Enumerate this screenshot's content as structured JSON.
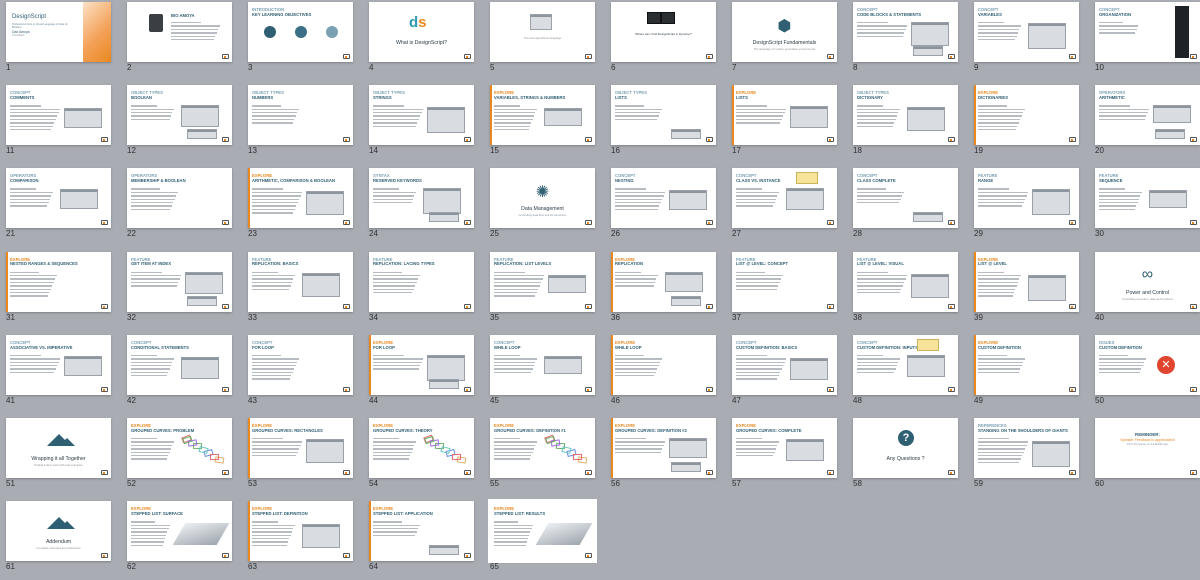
{
  "app": {
    "view": "Slide Sorter"
  },
  "slides": [
    {
      "n": "1",
      "layout": "title",
      "title": "DesignScript",
      "subtitle": "Professional Intro to Visual Language of Data for Builders",
      "presenter": "Dan Amoya",
      "role": "Consultant"
    },
    {
      "n": "2",
      "layout": "bio",
      "kicker": "",
      "title": "Bio Amoya"
    },
    {
      "n": "3",
      "layout": "objectives",
      "kicker": "Introduction",
      "title": "Key Learning Objectives"
    },
    {
      "n": "4",
      "layout": "ds",
      "kicker": "",
      "title": "What is DesignScript?"
    },
    {
      "n": "5",
      "layout": "media",
      "kicker": "",
      "title": "",
      "caption": "The best algorithmic language"
    },
    {
      "n": "6",
      "layout": "darkshots",
      "kicker": "",
      "title": "Where can I find DesignScript in Dynamo?"
    },
    {
      "n": "7",
      "layout": "section",
      "kicker": "",
      "title": "DesignScript Fundamentals",
      "sub": "The language of modern generative environments",
      "icon": "cube-icon",
      "glyph": "⬢"
    },
    {
      "n": "8",
      "layout": "concept",
      "kicker": "Concept",
      "title": "Code Blocks & Statements"
    },
    {
      "n": "9",
      "layout": "concept",
      "kicker": "Concept",
      "title": "Variables"
    },
    {
      "n": "10",
      "layout": "tall",
      "kicker": "Concept",
      "title": "Organization"
    },
    {
      "n": "11",
      "layout": "concept",
      "kicker": "Concept",
      "title": "Comments"
    },
    {
      "n": "12",
      "layout": "concept",
      "kicker": "Object Types",
      "title": "Boolean"
    },
    {
      "n": "13",
      "layout": "concept",
      "kicker": "Object Types",
      "title": "Numbers"
    },
    {
      "n": "14",
      "layout": "concept",
      "kicker": "Object Types",
      "title": "Strings"
    },
    {
      "n": "15",
      "layout": "explore",
      "kicker": "Explore",
      "title": "Variables, Strings & Numbers"
    },
    {
      "n": "16",
      "layout": "concept",
      "kicker": "Object Types",
      "title": "Lists"
    },
    {
      "n": "17",
      "layout": "explore",
      "kicker": "Explore",
      "title": "Lists"
    },
    {
      "n": "18",
      "layout": "concept",
      "kicker": "Object Types",
      "title": "Dictionary"
    },
    {
      "n": "19",
      "layout": "explore",
      "kicker": "Explore",
      "title": "Dictionaries"
    },
    {
      "n": "20",
      "layout": "concept",
      "kicker": "Operators",
      "title": "Arithmetic"
    },
    {
      "n": "21",
      "layout": "concept",
      "kicker": "Operators",
      "title": "Comparison"
    },
    {
      "n": "22",
      "layout": "concept",
      "kicker": "Operators",
      "title": "Membership & Boolean"
    },
    {
      "n": "23",
      "layout": "explore",
      "kicker": "Explore",
      "title": "Arithmetic, Comparison & Boolean"
    },
    {
      "n": "24",
      "layout": "concept",
      "kicker": "Syntax",
      "title": "Reserved Keywords"
    },
    {
      "n": "25",
      "layout": "section",
      "kicker": "",
      "title": "Data Management",
      "sub": "Controlling data flow and list structures",
      "icon": "network-icon",
      "glyph": "✺"
    },
    {
      "n": "26",
      "layout": "concept",
      "kicker": "Concept",
      "title": "Nesting"
    },
    {
      "n": "27",
      "layout": "concept-note",
      "kicker": "Concept",
      "title": "Class vs. Instance"
    },
    {
      "n": "28",
      "layout": "concept",
      "kicker": "Concept",
      "title": "Class Complete"
    },
    {
      "n": "29",
      "layout": "concept",
      "kicker": "Feature",
      "title": "Range"
    },
    {
      "n": "30",
      "layout": "concept",
      "kicker": "Feature",
      "title": "Sequence"
    },
    {
      "n": "31",
      "layout": "explore",
      "kicker": "Explore",
      "title": "Nested Ranges & Sequences"
    },
    {
      "n": "32",
      "layout": "concept",
      "kicker": "Feature",
      "title": "Get Item at Index"
    },
    {
      "n": "33",
      "layout": "concept",
      "kicker": "Feature",
      "title": "Replication: Basics"
    },
    {
      "n": "34",
      "layout": "concept",
      "kicker": "Feature",
      "title": "Replication: Lacing Types"
    },
    {
      "n": "35",
      "layout": "concept",
      "kicker": "Feature",
      "title": "Replication: List Levels"
    },
    {
      "n": "36",
      "layout": "explore",
      "kicker": "Explore",
      "title": "Replication"
    },
    {
      "n": "37",
      "layout": "concept",
      "kicker": "Feature",
      "title": "List @ Level: Concept"
    },
    {
      "n": "38",
      "layout": "concept",
      "kicker": "Feature",
      "title": "List @ Level: Visual"
    },
    {
      "n": "39",
      "layout": "explore",
      "kicker": "Explore",
      "title": "List @ Level"
    },
    {
      "n": "40",
      "layout": "infinity",
      "kicker": "",
      "title": "Power and Control",
      "sub": "Controlling execution, data and functions"
    },
    {
      "n": "41",
      "layout": "concept",
      "kicker": "Concept",
      "title": "Associative vs. Imperative"
    },
    {
      "n": "42",
      "layout": "concept",
      "kicker": "Concept",
      "title": "Conditional Statements"
    },
    {
      "n": "43",
      "layout": "concept",
      "kicker": "Concept",
      "title": "For Loop"
    },
    {
      "n": "44",
      "layout": "explore",
      "kicker": "Explore",
      "title": "For Loop"
    },
    {
      "n": "45",
      "layout": "concept",
      "kicker": "Concept",
      "title": "While Loop"
    },
    {
      "n": "46",
      "layout": "explore",
      "kicker": "Explore",
      "title": "While Loop"
    },
    {
      "n": "47",
      "layout": "concept",
      "kicker": "Concept",
      "title": "Custom Definition: Basics"
    },
    {
      "n": "48",
      "layout": "concept-note",
      "kicker": "Concept",
      "title": "Custom Definition: Inputs"
    },
    {
      "n": "49",
      "layout": "explore",
      "kicker": "Explore",
      "title": "Custom Definition"
    },
    {
      "n": "50",
      "layout": "issue",
      "kicker": "Issues",
      "title": "Custom Definition"
    },
    {
      "n": "51",
      "layout": "mountain",
      "kicker": "",
      "title": "Wrapping it all Together",
      "sub": "Putting it all to work with real examples"
    },
    {
      "n": "52",
      "layout": "rects",
      "kicker": "Explore",
      "title": "Grouped Curves: Problem"
    },
    {
      "n": "53",
      "layout": "explore",
      "kicker": "Explore",
      "title": "Grouped Curves: Rectangles"
    },
    {
      "n": "54",
      "layout": "rects",
      "kicker": "Explore",
      "title": "Grouped Curves: Theory"
    },
    {
      "n": "55",
      "layout": "rects",
      "kicker": "Explore",
      "title": "Grouped Curves: Definition #1"
    },
    {
      "n": "56",
      "layout": "explore",
      "kicker": "Explore",
      "title": "Grouped Curves: Definition #2"
    },
    {
      "n": "57",
      "layout": "concept",
      "kicker": "Explore",
      "title": "Grouped Curves: Complete"
    },
    {
      "n": "58",
      "layout": "question",
      "kicker": "",
      "title": "Any Questions ?"
    },
    {
      "n": "59",
      "layout": "concept",
      "kicker": "References",
      "title": "Standing on the Shoulders of Giants"
    },
    {
      "n": "60",
      "layout": "reminder",
      "kicker": "",
      "title": "REMINDER:",
      "line2": "Speaker Feedback is appreciated!",
      "line3": "Fill in the Survey on the Mobile App"
    },
    {
      "n": "61",
      "layout": "mountain",
      "kicker": "",
      "title": "Addendum",
      "sub": "Complete examples and references"
    },
    {
      "n": "62",
      "layout": "surface",
      "kicker": "Explore",
      "title": "Stepped List: Surface"
    },
    {
      "n": "63",
      "layout": "explore",
      "kicker": "Explore",
      "title": "Stepped List: Definition"
    },
    {
      "n": "64",
      "layout": "explore",
      "kicker": "Explore",
      "title": "Stepped List: Application"
    },
    {
      "n": "65",
      "layout": "surface",
      "kicker": "Explore",
      "title": "Stepped List: Results"
    }
  ],
  "colors": {
    "accent": "#e8881f",
    "primary": "#2f5f73",
    "background": "#a9acb3"
  }
}
